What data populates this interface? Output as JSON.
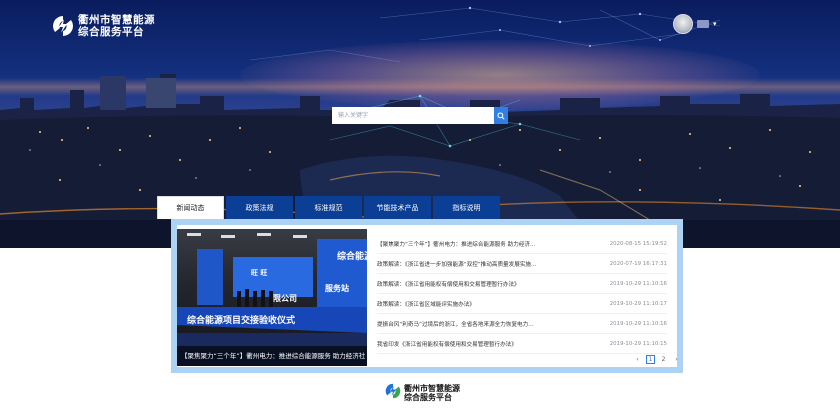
{
  "header": {
    "brand_line1": "衢州市智慧能源",
    "brand_line2": "综合服务平台",
    "user_name": "",
    "caret": "▾"
  },
  "search": {
    "placeholder": "输入关键字"
  },
  "tabs": [
    {
      "label": "新闻动态",
      "active": true
    },
    {
      "label": "政策法规",
      "active": false
    },
    {
      "label": "标准规范",
      "active": false
    },
    {
      "label": "节能技术产品",
      "active": false
    },
    {
      "label": "指标说明",
      "active": false
    }
  ],
  "featured": {
    "caption": "【聚焦聚力“三个年”】衢州电力：推进综合能源服务 助力经济社",
    "photo_text": {
      "sign1": "综合能源",
      "sign2": "服务站",
      "banner": "综合能源项目交接验收仪式",
      "company": "限公司",
      "small": "旺 旺"
    }
  },
  "news": [
    {
      "title": "【聚焦聚力“三个年”】衢州电力：推进综合能源服务 助力经济...",
      "date": "2020-08-15 15:19:52"
    },
    {
      "title": "政策解读：《浙江省进一步加强能源“双控”推动高质量发展实施...",
      "date": "2020-07-19 16:17:31"
    },
    {
      "title": "政策解读：《浙江省用能权有偿使用和交易管理暂行办法》",
      "date": "2019-10-29 11:10:16"
    },
    {
      "title": "政策解读：《浙江省区域能评实施办法》",
      "date": "2019-10-29 11:10:17"
    },
    {
      "title": "提振台风“利奇马”过境后的浙江，全省各地来源全力恢复电力...",
      "date": "2019-10-29 11:10:16"
    },
    {
      "title": "我省印发《浙江省用能权有偿使用和交易管理暂行办法》",
      "date": "2019-10-29 11:10:15"
    }
  ],
  "pagination": {
    "prev": "‹",
    "pages": [
      "1",
      "2"
    ],
    "current": "1",
    "next": "›"
  },
  "footer": {
    "brand_line1": "衢州市智慧能源",
    "brand_line2": "综合服务平台"
  },
  "colors": {
    "tab_bg": "#0b3f96",
    "panel_border": "#acd3f3",
    "search_button": "#2f7fe6",
    "logo_blue": "#1d73d8",
    "logo_green": "#3aa655"
  }
}
